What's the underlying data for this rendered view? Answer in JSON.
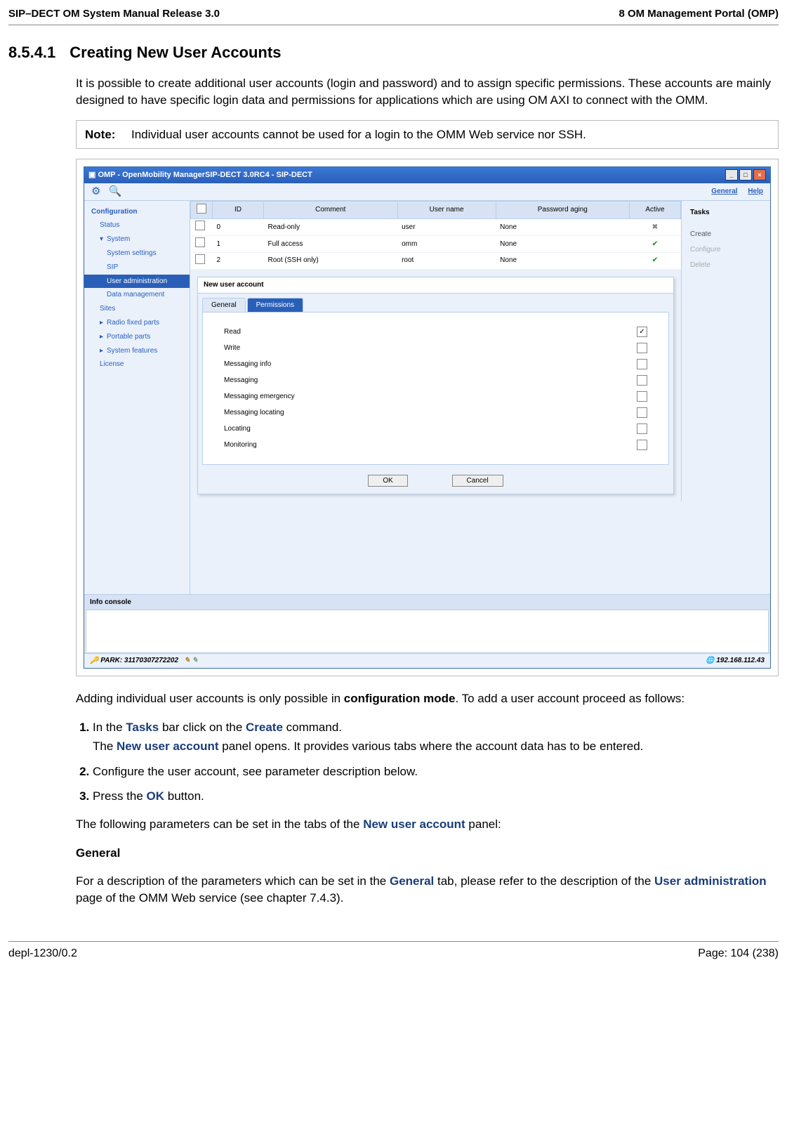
{
  "header_left": "SIP–DECT OM System Manual Release 3.0",
  "header_right": "8 OM Management Portal (OMP)",
  "section_num": "8.5.4.1",
  "section_title": "Creating New User Accounts",
  "intro_para": "It is possible to create additional user accounts (login and password) and to assign specific permissions. These accounts are mainly designed to have specific login data and permissions for applications which are using OM AXI to connect with the OMM.",
  "note_label": "Note:",
  "note_text": "Individual user accounts cannot be used for a login to the OMM Web service nor SSH.",
  "omp": {
    "title": "OMP - OpenMobility ManagerSIP-DECT 3.0RC4 - SIP-DECT",
    "menu_general": "General",
    "menu_help": "Help",
    "nav_header": "Configuration",
    "nav_items": [
      "Status",
      "System",
      "System settings",
      "SIP",
      "User administration",
      "Data management",
      "Sites",
      "Radio fixed parts",
      "Portable parts",
      "System features",
      "License"
    ],
    "table_headers": [
      "",
      "ID",
      "Comment",
      "User name",
      "Password aging",
      "Active"
    ],
    "table_rows": [
      [
        "0",
        "Read-only",
        "user",
        "None",
        "x"
      ],
      [
        "1",
        "Full access",
        "omm",
        "None",
        "v"
      ],
      [
        "2",
        "Root (SSH only)",
        "root",
        "None",
        "v"
      ]
    ],
    "tasks_header": "Tasks",
    "tasks": [
      "Create",
      "Configure",
      "Delete"
    ],
    "panel_title": "New user account",
    "tab_general": "General",
    "tab_permissions": "Permissions",
    "perm_rows": [
      "Read",
      "Write",
      "Messaging info",
      "Messaging",
      "Messaging emergency",
      "Messaging locating",
      "Locating",
      "Monitoring"
    ],
    "btn_ok": "OK",
    "btn_cancel": "Cancel",
    "console_label": "Info console",
    "status_left": "PARK: 31170307272202",
    "status_right": "192.168.112.43"
  },
  "para_after1a": "Adding individual user accounts is only possible in ",
  "para_after1b": "configuration mode",
  "para_after1c": ". To add a user account proceed as follows:",
  "step1a": "In the ",
  "step1_tasks": "Tasks",
  "step1b": " bar click on the ",
  "step1_create": "Create",
  "step1c": " command.",
  "step1d": "The ",
  "step1_panel": "New user account",
  "step1e": " panel opens. It provides various tabs where the account data has to be entered.",
  "step2": "Configure the user account, see parameter description below.",
  "step3a": "Press the ",
  "step3_ok": "OK",
  "step3b": " button.",
  "para_after2a": "The following parameters can be set in the tabs of the ",
  "para_after2_panel": "New user account",
  "para_after2b": " panel:",
  "sub_general": "General",
  "sub_general_para_a": "For a description of the parameters which can be set in the ",
  "sub_general_para_tab": "General",
  "sub_general_para_b": " tab, please refer to the description of the ",
  "sub_general_para_page": "User administration",
  "sub_general_para_c": " page of the OMM Web service (see chapter 7.4.3).",
  "footer_left": "depl-1230/0.2",
  "footer_right": "Page: 104 (238)"
}
